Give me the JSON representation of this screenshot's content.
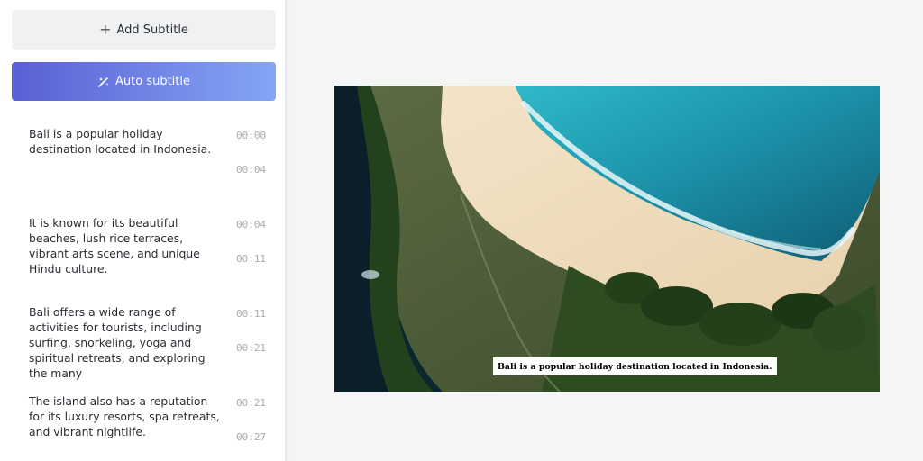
{
  "toolbar": {
    "add_subtitle_label": "Add Subtitle",
    "add_icon": "plus-icon",
    "auto_subtitle_label": "Auto subtitle",
    "auto_icon": "magic-wand-icon"
  },
  "subtitles": [
    {
      "text": "Bali is a popular holiday destination located in Indonesia.",
      "start": "00:00",
      "end": "00:04"
    },
    {
      "text": "It is known for its beautiful beaches, lush rice terraces, vibrant arts scene, and unique Hindu culture.",
      "start": "00:04",
      "end": "00:11"
    },
    {
      "text": "Bali offers a wide range of activities for tourists, including surfing, snorkeling, yoga and spiritual retreats, and exploring the many",
      "start": "00:11",
      "end": "00:21"
    },
    {
      "text": "The island also has a reputation for its luxury resorts, spa retreats, and vibrant nightlife.",
      "start": "00:21",
      "end": "00:27"
    }
  ],
  "preview": {
    "caption": "Bali is a popular holiday destination located in Indonesia."
  },
  "colors": {
    "auto_gradient_start": "#5a5fd4",
    "auto_gradient_end": "#84a6f5",
    "panel_bg": "#ffffff",
    "canvas_bg": "#f4f5f7"
  }
}
